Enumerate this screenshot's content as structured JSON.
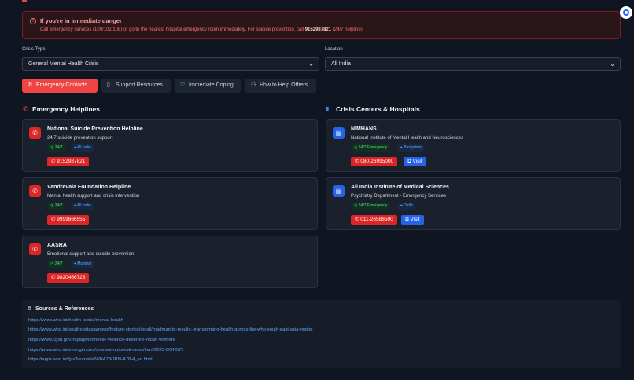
{
  "danger": {
    "title": "If you're in immediate danger",
    "text_before": "Call emergency services (100/102/108) or go to the nearest hospital emergency room immediately. For suicide prevention, call ",
    "number": "9152987821",
    "text_after": " (24/7 helpline)."
  },
  "filters": {
    "crisis_label": "Crisis Type",
    "crisis_value": "General Mental Health Crisis",
    "location_label": "Location",
    "location_value": "All India"
  },
  "tabs": [
    {
      "label": "Emergency Contacts"
    },
    {
      "label": "Support Resources"
    },
    {
      "label": "Immediate Coping"
    },
    {
      "label": "How to Help Others"
    }
  ],
  "helplines": {
    "title": "Emergency Helplines",
    "items": [
      {
        "name": "National Suicide Prevention Helpline",
        "desc": "24/7 suicide prevention support",
        "hours": "24/7",
        "area": "All India",
        "phone": "9152987821"
      },
      {
        "name": "Vandrevala Foundation Helpline",
        "desc": "Mental health support and crisis intervention",
        "hours": "24/7",
        "area": "All India",
        "phone": "9999666555"
      },
      {
        "name": "AASRA",
        "desc": "Emotional support and suicide prevention",
        "hours": "24/7",
        "area": "Mumbai",
        "phone": "9820466726"
      }
    ]
  },
  "centers": {
    "title": "Crisis Centers & Hospitals",
    "visit_label": "Visit",
    "items": [
      {
        "name": "NIMHANS",
        "desc": "National Institute of Mental Health and Neurosciences",
        "hours": "24/7 Emergency",
        "area": "Bangalore",
        "phone": "080-26995000"
      },
      {
        "name": "All India Institute of Medical Sciences",
        "desc": "Psychiatry Department - Emergency Services",
        "hours": "24/7 Emergency",
        "area": "Delhi",
        "phone": "011-26588500"
      }
    ]
  },
  "sources": {
    "title": "Sources & References",
    "links": [
      "https://www.who.int/health-topics/mental-health",
      "https://www.who.int/southeastasia/news/feature-stories/detail/roadmap-to-results--transforming-health-across-the-who-south-east-asia-region",
      "https://www.cgisf.gov.in/page/domestic-violence-deserted-indian-women/",
      "https://www.who.int/emergencies/disease-outbreak-news/item/2025-DON572",
      "https://apps.who.int/gb/Journal/e/WHA78/JRN-A78-4_en.html"
    ]
  },
  "colors": {
    "accent_red": "#ef4444",
    "accent_blue": "#2563eb",
    "background": "#0f1521"
  }
}
